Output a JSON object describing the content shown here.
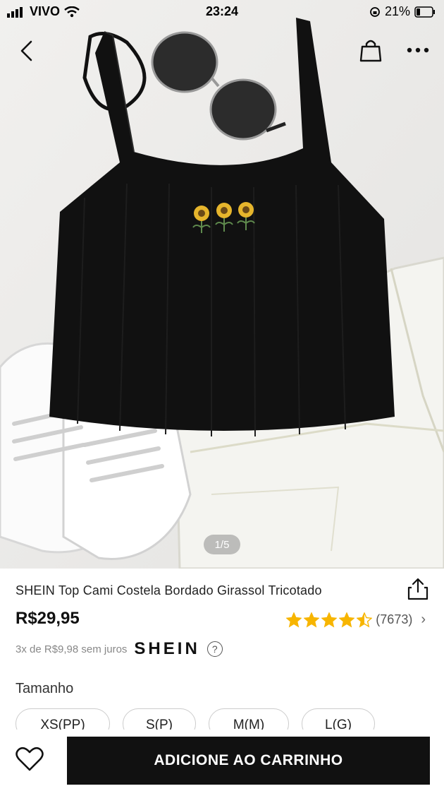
{
  "status_bar": {
    "carrier": "VIVO",
    "time": "23:24",
    "battery": "21%"
  },
  "gallery": {
    "pager": "1/5",
    "current": 1,
    "total": 5
  },
  "product": {
    "title": "SHEIN Top Cami Costela Bordado Girassol Tricotado",
    "price": "R$29,95",
    "rating": 4.5,
    "review_count": "(7673)",
    "installments": "3x de R$9,98 sem juros",
    "brand": "SHEIN",
    "help_glyph": "?"
  },
  "sizes": {
    "label": "Tamanho",
    "options": [
      "XS(PP)",
      "S(P)",
      "M(M)",
      "L(G)"
    ]
  },
  "cart": {
    "button_label": "ADICIONE AO CARRINHO"
  },
  "icons": [
    "back-arrow-icon",
    "shopping-bag-icon",
    "more-icon",
    "share-icon",
    "star-icon",
    "chevron-right-icon",
    "heart-icon"
  ],
  "colors": {
    "star": "#f7b500",
    "cta_background": "#111111"
  }
}
